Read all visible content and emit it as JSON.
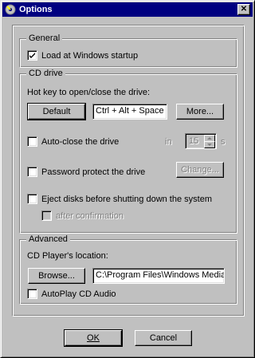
{
  "window": {
    "title": "Options",
    "close_glyph": "✕"
  },
  "general": {
    "title": "General",
    "load_at_startup": {
      "label": "Load at Windows startup",
      "checked": true
    }
  },
  "cd_drive": {
    "title": "CD drive",
    "hotkey_label": "Hot key to open/close the drive:",
    "default_button": "Default",
    "hotkey_value": "Ctrl + Alt + Space",
    "more_button": "More...",
    "auto_close": {
      "label": "Auto-close the drive",
      "checked": false
    },
    "in_label": "in",
    "seconds_value": "15",
    "seconds_unit": "s",
    "password": {
      "label": "Password protect the drive",
      "checked": false
    },
    "change_button": "Change...",
    "eject": {
      "label": "Eject disks before shutting down the system",
      "checked": false
    },
    "after_confirmation": {
      "label": "after confirmation",
      "checked": false,
      "enabled": false
    }
  },
  "advanced": {
    "title": "Advanced",
    "location_label": "CD Player's location:",
    "browse_button": "Browse...",
    "location_value": "C:\\Program Files\\Windows Media",
    "autoplay": {
      "label": "AutoPlay CD Audio",
      "checked": false
    }
  },
  "footer": {
    "ok_button": "OK",
    "cancel_button": "Cancel"
  },
  "icons": {
    "app": "cd-app-icon",
    "check": "check-icon",
    "spin_up": "spin-up-icon",
    "spin_down": "spin-down-icon"
  },
  "colors": {
    "titlebar": "#000080",
    "face": "#c0c0c0",
    "disabled_text": "#808080"
  }
}
